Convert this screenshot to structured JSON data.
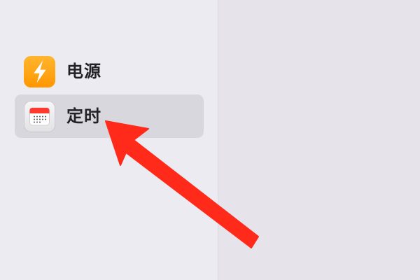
{
  "sidebar": {
    "items": [
      {
        "label": "电源",
        "icon": "lightning-bolt-icon",
        "icon_color": "#ff9f0a",
        "selected": false
      },
      {
        "label": "定时",
        "icon": "calendar-icon",
        "icon_color": "#ff3b30",
        "selected": true
      }
    ]
  },
  "annotation": {
    "type": "arrow",
    "color": "#ff2a1a"
  }
}
